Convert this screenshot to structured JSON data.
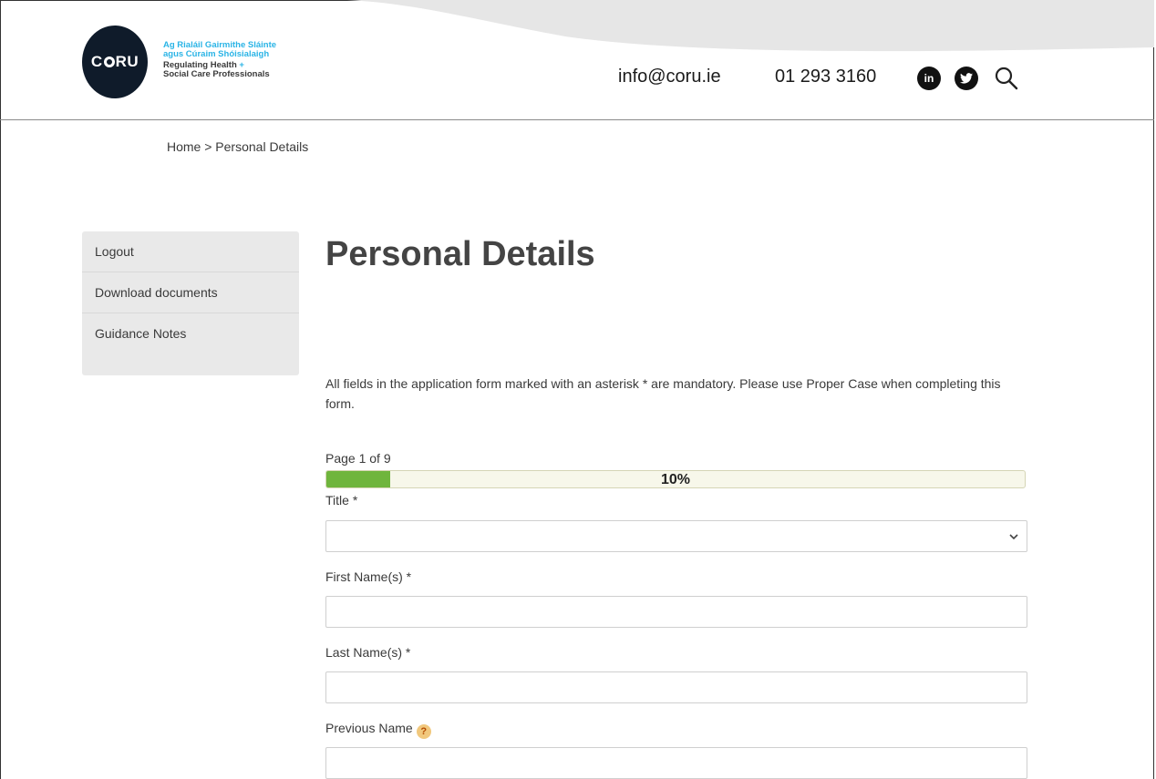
{
  "brand": {
    "logo_text_c": "C",
    "logo_text_ru": "RU",
    "tagline_irish_1": "Ag Rialáil Gairmithe Sláinte",
    "tagline_irish_2": "agus Cúraim Shóisialaigh",
    "tagline_en_1": "Regulating Health",
    "tagline_en_plus": "+",
    "tagline_en_2": "Social Care Professionals",
    "accent_color": "#2ab4e6",
    "dark_color": "#0f1b2a"
  },
  "header": {
    "email": "info@coru.ie",
    "phone": "01 293 3160",
    "linkedin_icon": "linkedin-icon",
    "linkedin_label": "in",
    "twitter_icon": "twitter-icon",
    "search_icon": "search-icon"
  },
  "breadcrumb": "Home > Personal Details",
  "sidebar": {
    "items": [
      {
        "label": "Logout"
      },
      {
        "label": "Download documents"
      },
      {
        "label": "Guidance Notes"
      }
    ]
  },
  "page": {
    "title": "Personal Details",
    "intro": "All fields in the application form marked with an asterisk * are mandatory. Please use Proper Case when completing this form.",
    "page_of": "Page 1 of 9",
    "progress_percent": 10,
    "progress_label": "10%",
    "progress_color": "#6fb53d"
  },
  "form": {
    "title_label": "Title *",
    "title_value": "",
    "first_name_label": "First Name(s) *",
    "first_name_value": "",
    "last_name_label": "Last Name(s) *",
    "last_name_value": "",
    "previous_name_label": "Previous Name",
    "previous_name_value": "",
    "help_icon": "help-icon",
    "help_glyph": "?"
  }
}
